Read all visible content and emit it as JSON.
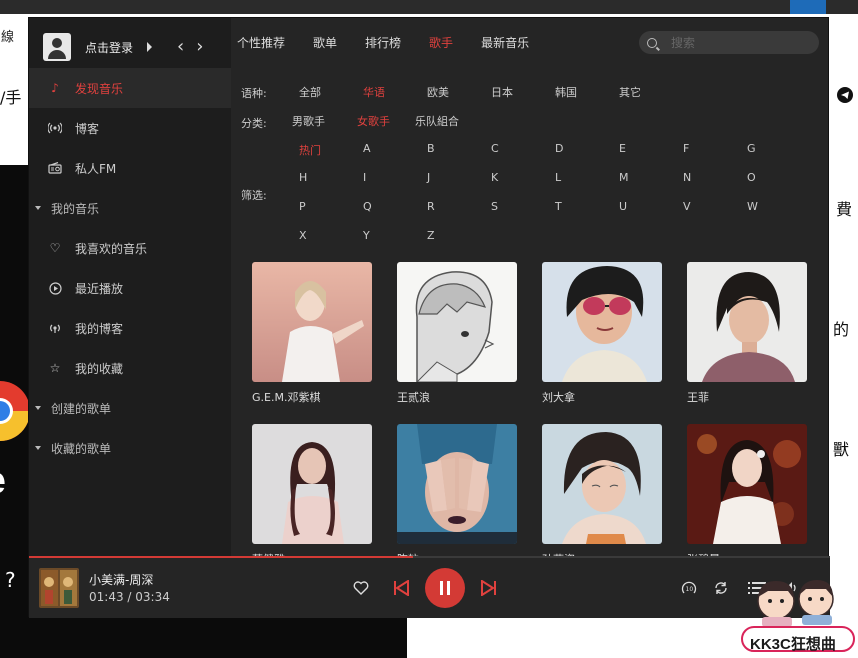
{
  "background": {
    "left_texts": [
      "/手",
      "?"
    ],
    "right_texts": [
      "費",
      "的",
      "獸"
    ],
    "top_left_text": "線"
  },
  "sidebar": {
    "login_label": "点击登录",
    "items": [
      {
        "label": "发现音乐",
        "icon": "music-note-icon",
        "active": true
      },
      {
        "label": "博客",
        "icon": "podcast-icon"
      },
      {
        "label": "私人FM",
        "icon": "radio-icon"
      }
    ],
    "my_music_group": "我的音乐",
    "my_music_items": [
      {
        "label": "我喜欢的音乐",
        "icon": "heart-icon"
      },
      {
        "label": "最近播放",
        "icon": "recent-play-icon"
      },
      {
        "label": "我的博客",
        "icon": "podcast-icon"
      },
      {
        "label": "我的收藏",
        "icon": "star-icon"
      }
    ],
    "created_playlists": "创建的歌单",
    "collected_playlists": "收藏的歌单"
  },
  "tabs": [
    {
      "label": "个性推荐",
      "active": false
    },
    {
      "label": "歌单",
      "active": false
    },
    {
      "label": "排行榜",
      "active": false
    },
    {
      "label": "歌手",
      "active": true
    },
    {
      "label": "最新音乐",
      "active": false
    }
  ],
  "search": {
    "placeholder": "搜索"
  },
  "filters": {
    "language_label": "语种:",
    "language_options": [
      "全部",
      "华语",
      "欧美",
      "日本",
      "韩国",
      "其它"
    ],
    "language_selected": "华语",
    "category_label": "分类:",
    "category_options": [
      "男歌手",
      "女歌手",
      "乐队組合"
    ],
    "category_selected": "女歌手",
    "filter_label": "筛选:",
    "letter_options": [
      "热门",
      "A",
      "B",
      "C",
      "D",
      "E",
      "F",
      "G",
      "H",
      "I",
      "J",
      "K",
      "L",
      "M",
      "N",
      "O",
      "P",
      "Q",
      "R",
      "S",
      "T",
      "U",
      "V",
      "W",
      "X",
      "Y",
      "Z"
    ],
    "letter_selected": "热门"
  },
  "artists": [
    {
      "name": "G.E.M.邓紫棋"
    },
    {
      "name": "王贰浪"
    },
    {
      "name": "刘大拿"
    },
    {
      "name": "王菲"
    },
    {
      "name": "蔡健雅"
    },
    {
      "name": "陈粒"
    },
    {
      "name": "孙燕姿"
    },
    {
      "name": "张碧晨"
    }
  ],
  "player": {
    "song": "小美满-周深",
    "time": "01:43 / 03:34",
    "progress_fraction": 0.48,
    "accent_color": "#d33a35"
  },
  "watermark": {
    "text": "KK3C狂想曲"
  }
}
